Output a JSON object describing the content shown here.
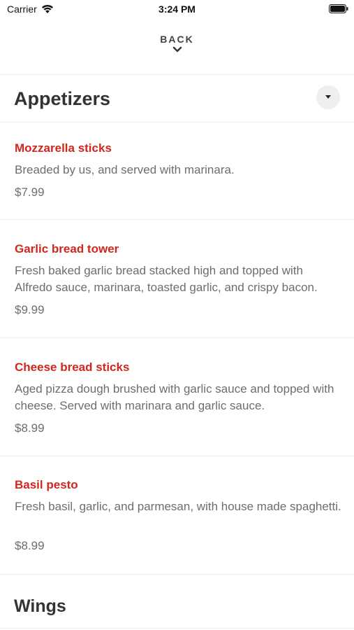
{
  "status_bar": {
    "carrier": "Carrier",
    "time": "3:24 PM"
  },
  "nav": {
    "back_label": "BACK"
  },
  "sections": [
    {
      "title": "Appetizers",
      "items": [
        {
          "name": "Mozzarella sticks",
          "description": "Breaded by us, and served with marinara.",
          "price": "$7.99"
        },
        {
          "name": "Garlic bread tower",
          "description": "Fresh baked garlic bread stacked high and topped with Alfredo sauce, marinara, toasted garlic, and crispy bacon.",
          "price": "$9.99"
        },
        {
          "name": "Cheese bread sticks",
          "description": "Aged pizza dough brushed with garlic sauce and topped with cheese. Served with marinara and garlic sauce.",
          "price": "$8.99"
        },
        {
          "name": "Basil pesto",
          "description": "Fresh basil, garlic, and parmesan, with house made spaghetti.",
          "price": "$8.99"
        }
      ]
    },
    {
      "title": "Wings",
      "items": []
    }
  ],
  "colors": {
    "accent": "#d0271d",
    "body_text": "#6d6d6d",
    "divider": "#ececec"
  },
  "icons": {
    "wifi": "wifi-icon",
    "battery": "battery-icon",
    "back_chevron": "chevron-down-icon",
    "collapse": "caret-down-icon"
  }
}
